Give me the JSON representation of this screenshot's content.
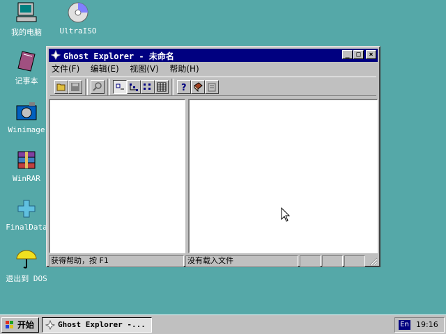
{
  "desktop": {
    "icons": [
      {
        "label": "我的电脑",
        "icon": "computer-icon"
      },
      {
        "label": "UltraISO",
        "icon": "cd-icon"
      },
      {
        "label": "记事本",
        "icon": "notebook-icon"
      },
      {
        "label": "Winimage",
        "icon": "camera-icon"
      },
      {
        "label": "WinRAR",
        "icon": "archive-icon"
      },
      {
        "label": "FinalData",
        "icon": "recover-icon"
      },
      {
        "label": "退出到 DOS",
        "icon": "umbrella-icon"
      }
    ]
  },
  "window": {
    "title": "Ghost Explorer - 未命名",
    "controls": {
      "minimize": "_",
      "maximize": "□",
      "close": "×"
    },
    "menu": [
      "文件(F)",
      "编辑(E)",
      "视图(V)",
      "帮助(H)"
    ],
    "status": {
      "help": "获得帮助，按 F1",
      "file": "没有载入文件"
    }
  },
  "taskbar": {
    "start_label": "开始",
    "task_label": "Ghost Explorer -...",
    "lang": "En",
    "clock": "19:16"
  },
  "colors": {
    "desktop": "#55a8a8",
    "titlebar": "#000080",
    "face": "#c0c0c0"
  }
}
